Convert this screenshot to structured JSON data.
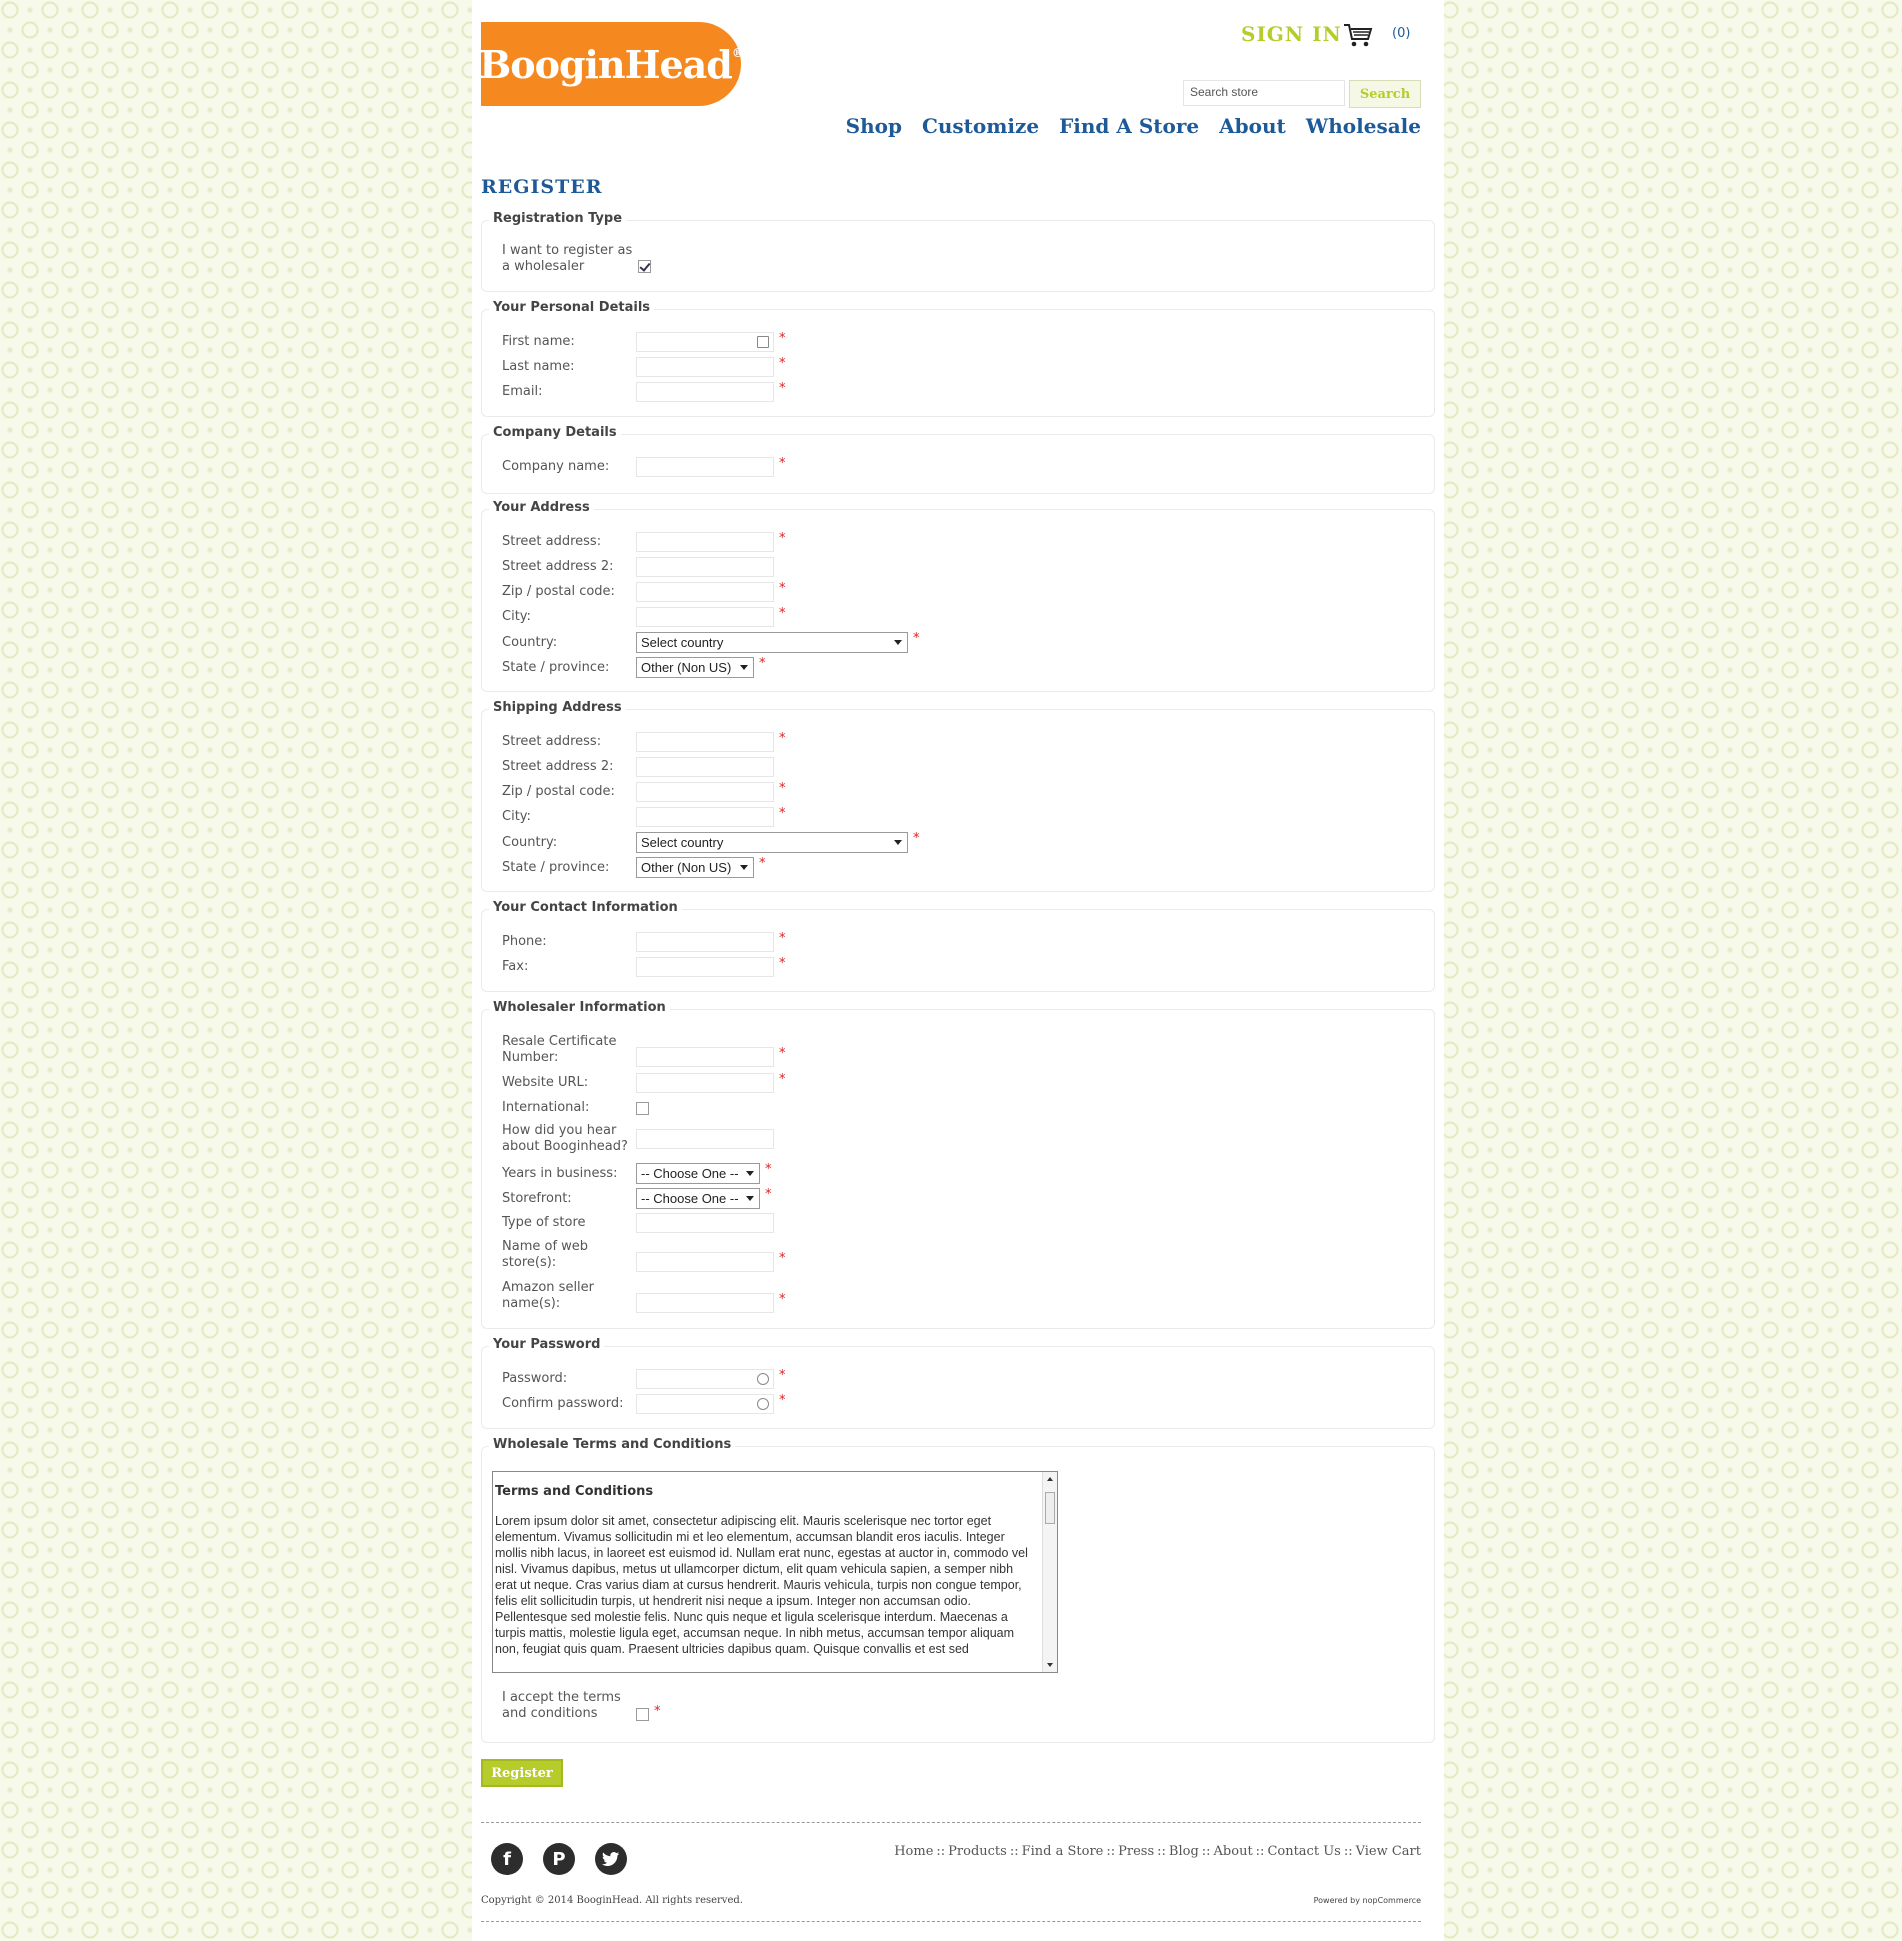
{
  "header": {
    "logo_text": "BooginHead",
    "logo_mark": "®",
    "signin": "SIGN IN",
    "cart_count": "(0)",
    "search_placeholder": "Search store",
    "search_button": "Search",
    "nav": [
      "Shop",
      "Customize",
      "Find A Store",
      "About",
      "Wholesale"
    ]
  },
  "page_title": "REGISTER",
  "registration_type": {
    "legend": "Registration Type",
    "label": "I want to register as a wholesaler",
    "checked": true
  },
  "personal": {
    "legend": "Your Personal Details",
    "first_name": "First name:",
    "last_name": "Last name:",
    "email": "Email:"
  },
  "company": {
    "legend": "Company Details",
    "company_name": "Company name:"
  },
  "address": {
    "legend": "Your Address",
    "street": "Street address:",
    "street2": "Street address 2:",
    "zip": "Zip / postal code:",
    "city": "City:",
    "country": "Country:",
    "country_value": "Select country",
    "state": "State / province:",
    "state_value": "Other (Non US)"
  },
  "shipping": {
    "legend": "Shipping Address",
    "street": "Street address:",
    "street2": "Street address 2:",
    "zip": "Zip / postal code:",
    "city": "City:",
    "country": "Country:",
    "country_value": "Select country",
    "state": "State / province:",
    "state_value": "Other (Non US)"
  },
  "contact": {
    "legend": "Your Contact Information",
    "phone": "Phone:",
    "fax": "Fax:"
  },
  "wholesaler": {
    "legend": "Wholesaler Information",
    "resale": "Resale Certificate Number:",
    "website": "Website URL:",
    "international": "International:",
    "hear": "How did you hear about Booginhead?",
    "years": "Years in business:",
    "years_value": "-- Choose One --",
    "storefront": "Storefront:",
    "storefront_value": "-- Choose One --",
    "type_of_store": "Type of store",
    "web_stores": "Name of web store(s):",
    "amazon": "Amazon seller name(s):"
  },
  "password": {
    "legend": "Your Password",
    "password": "Password:",
    "confirm": "Confirm password:"
  },
  "terms": {
    "legend": "Wholesale Terms and Conditions",
    "title": "Terms and Conditions",
    "body": "Lorem ipsum dolor sit amet, consectetur adipiscing elit. Mauris scelerisque nec tortor eget elementum. Vivamus sollicitudin mi et leo elementum, accumsan blandit eros iaculis. Integer mollis nibh lacus, in laoreet est euismod id. Nullam erat nunc, egestas at auctor in, commodo vel nisl. Vivamus dapibus, metus ut ullamcorper dictum, elit quam vehicula sapien, a semper nibh erat ut neque. Cras varius diam at cursus hendrerit. Mauris vehicula, turpis non congue tempor, felis elit sollicitudin turpis, ut hendrerit nisi neque a ipsum. Integer non accumsan odio. Pellentesque sed molestie felis. Nunc quis neque et ligula scelerisque interdum. Maecenas a turpis mattis, molestie ligula eget, accumsan neque. In nibh metus, accumsan tempor aliquam non, feugiat quis quam. Praesent ultricies dapibus quam. Quisque convallis et est sed",
    "accept": "I accept the terms and conditions"
  },
  "register_button": "Register",
  "footer": {
    "links": [
      "Home",
      "Products",
      "Find a Store",
      "Press",
      "Blog",
      "About",
      "Contact Us",
      "View Cart"
    ],
    "separator": "::",
    "copyright": "Copyright © 2014 BooginHead. All rights reserved.",
    "powered": "Powered by nopCommerce"
  }
}
